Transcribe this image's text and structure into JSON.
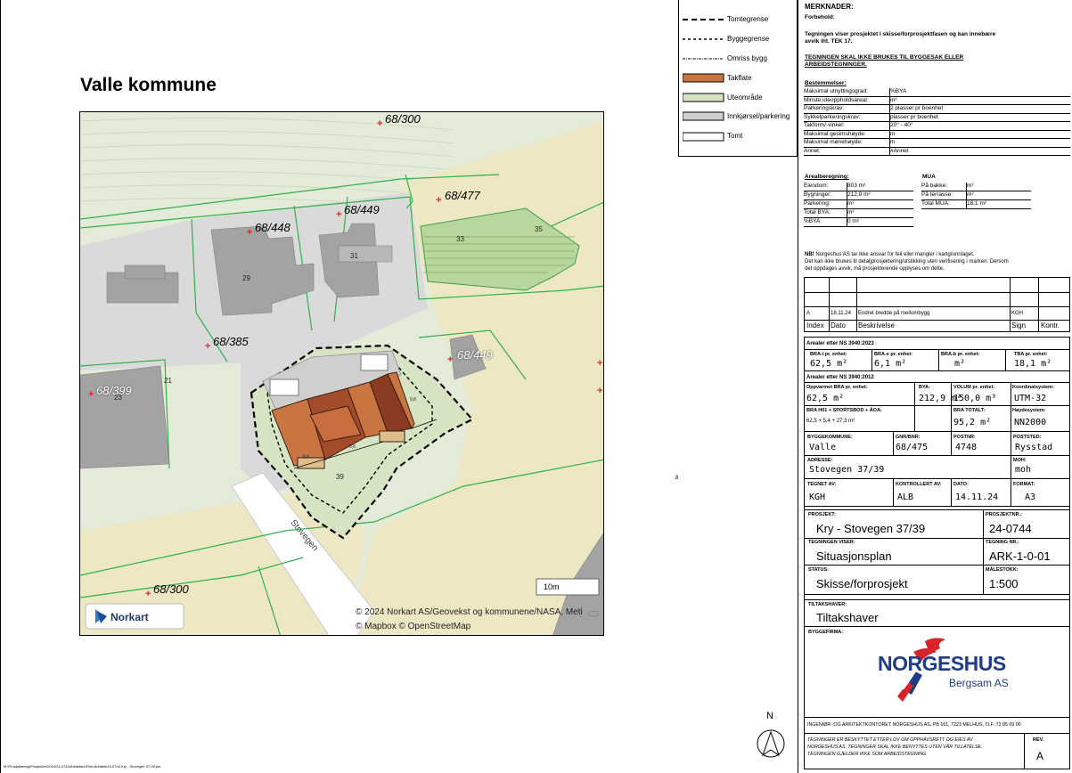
{
  "title": "Valle kommune",
  "map": {
    "attribution_line1": "© 2024 Norkart AS/Geovekst og kommunene/NASA, Meti",
    "attribution_line2": "© Mapbox © OpenStreetMap",
    "logo_text": "Norkart",
    "scale_label": "10m",
    "street_name": "Stovegen",
    "parcels": [
      "68/300",
      "68/477",
      "68/449",
      "68/448",
      "68/385",
      "68/449",
      "68/399",
      "68/300"
    ],
    "house_numbers": [
      "33",
      "35",
      "31",
      "29",
      "21",
      "23",
      "39"
    ],
    "dims": [
      "6,6",
      "5,6",
      "9,8"
    ],
    "side_mark": "8"
  },
  "legend": {
    "items": [
      "Tomtegrense",
      "Byggegrense",
      "Omriss bygg",
      "Takflate",
      "Uteområde",
      "Innkjørsel/parkering",
      "Tomt"
    ],
    "colors": {
      "roof": "#c97542",
      "outdoor": "#d6e4c3",
      "drive": "#cfcfcf"
    }
  },
  "notes": {
    "heading": "MERKNADER:",
    "forbehold": "Forbehold:",
    "line1": "Tegningen viser prosjektet i skisse/forprosjektfasen og kan innebære",
    "line2": "avvik iht. TEK 17.",
    "warn1": "TEGNINGEN SKAL IKKE BRUKES TIL BYGGESAK ELLER",
    "warn2": "ARBEIDSTEGNINGER."
  },
  "bestemmelser": {
    "heading": "Bestemmelser:",
    "rows": [
      [
        "Maksimal utnyttingsgrad:",
        "%BYA"
      ],
      [
        "Minste uteoppholdsareal:",
        "m²"
      ],
      [
        "Parkeringskrav:",
        "2 plasser pr boenhet"
      ],
      [
        "Sykkelparkeringskrav:",
        "plasser pr boenhet"
      ],
      [
        "Takform/-vinkel:",
        "20° - 40°"
      ],
      [
        "Maksimal gesimshøyde:",
        "m"
      ],
      [
        "Maksimal mønehøyde:",
        "m"
      ],
      [
        "Annet:",
        "#Annet"
      ]
    ]
  },
  "arealberegning": {
    "heading": "Arealberegning:",
    "rows": [
      [
        "Eiendom:",
        "803 m²"
      ],
      [
        "Bygninger:",
        "212,9 m²"
      ],
      [
        "Parkering:",
        "m²"
      ],
      [
        "Total BYA:",
        "m²"
      ],
      [
        "%BYA:",
        "0 m²"
      ]
    ]
  },
  "mua": {
    "heading": "MUA",
    "rows": [
      [
        "På bakke:",
        "m²"
      ],
      [
        "På terrasse:",
        "m²"
      ],
      [
        "Total MUA:",
        "18,1 m²"
      ]
    ]
  },
  "disclaimer": {
    "nb": "NB!",
    "line1": " Norgeshus AS tar ikke ansvar for feil eller mangler i kartgrunnlaget.",
    "line2": "Det kan ikke brukes til detaljprosjektering/utstikking uten verifisering i marken. Dersom",
    "line3": "det oppdages avvik, må prosjekterende opplyses om dette."
  },
  "revisions": {
    "row": [
      "A",
      "18.11.24",
      "Endret bredde på mellombygg",
      "KGH",
      ""
    ],
    "headers": [
      "Index",
      "Dato",
      "Beskrivelse",
      "Sign",
      "Kontr."
    ]
  },
  "ns2023": {
    "heading": "Arealer etter NS 3940:2023",
    "cells": [
      {
        "label": "BRA-i pr. enhet:",
        "value": "62,5 m²"
      },
      {
        "label": "BRA-e pr. enhet:",
        "value": "6,1 m²"
      },
      {
        "label": "BRA-b pr. enhet:",
        "value": "m²"
      },
      {
        "label": "TBA pr. enhet:",
        "value": "18,1 m²"
      }
    ]
  },
  "ns2012": {
    "heading": "Arealer etter NS 3940:2012",
    "cells": [
      {
        "label": "Oppvarmet BRA pr. enhet:",
        "value": "62,5 m²"
      },
      {
        "label": "BYA:",
        "value": "212,9 m²"
      },
      {
        "label": "VOLUM pr. enhet:",
        "value": "150,0 m³"
      },
      {
        "label": "Koordinatsystem:",
        "value": "UTM-32"
      }
    ],
    "cells2": [
      {
        "label": "BRA H01 + SPORTSBOD + ÅOA:",
        "value": "62,5 + 5,4 + 27,3 m²"
      },
      {
        "label": "BRA TOTALT:",
        "value": "95,2 m²"
      },
      {
        "label": "Høydesystem:",
        "value": "NN2000"
      }
    ]
  },
  "property": {
    "kommune_label": "BYGGEKOMMUNE:",
    "kommune": "Valle",
    "gnr_label": "GNR/BNR:",
    "gnr": "68/475",
    "postnr_label": "POSTNR:",
    "postnr": "4748",
    "poststed_label": "POSTSTED:",
    "poststed": "Rysstad",
    "adresse_label": "ADRESSE:",
    "adresse": "Stovegen 37/39",
    "moh_label": "MOH:",
    "moh": "moh"
  },
  "drawing": {
    "tegnet_label": "TEGNET AV:",
    "tegnet": "KGH",
    "kontrollert_label": "KONTROLLERT AV:",
    "kontrollert": "ALB",
    "dato_label": "DATO:",
    "dato": "14.11.24",
    "format_label": "FORMAT:",
    "format": "A3"
  },
  "project": {
    "prosjekt_label": "PROSJEKT:",
    "prosjekt": "Kry - Stovegen 37/39",
    "prosjektnr_label": "PROSJEKTNR.:",
    "prosjektnr": "24-0744",
    "viser_label": "TEGNINGEN VISER:",
    "viser": "Situasjonsplan",
    "tegningnr_label": "TEGNING NR.:",
    "tegningnr": "ARK-1-0-01",
    "status_label": "STATUS:",
    "status": "Skisse/forprosjekt",
    "malestokk_label": "MÅLESTOKK:",
    "malestokk": "1:500"
  },
  "tiltakshaver": {
    "label": "TILTAKSHAVER:",
    "value": "Tiltakshaver"
  },
  "byggefirma": {
    "label": "BYGGEFIRMA:",
    "brand": "NORGESHUS",
    "sub": "Bergsam AS"
  },
  "north": "N",
  "footer": {
    "address": "INGENIØR- OG ARKITEKTKONTORET NORGESHUS AS, PB 161, 7223 MELHUS, TLF: 72 85 69 00",
    "legal1": "TEGNINGER ER BESKYTTET ETTER LOV OM OPPHAVSRETT OG EIES AV",
    "legal2": "NORGESHUS AS. TEGNINGER SKAL IKKE BENYTTES UTEN VÅR TILLATELSE.",
    "legal3": "TEGNINGEN GJELDER IKKE SOM ARBEIDSTEGNING.",
    "rev_label": "REV.",
    "rev": "A"
  },
  "filepath": "M:\\Prosjektering\\Prosjekter\\2024\\24-0744\\Arkitektur\\Filer\\Arkitekt\\24-0744 Kry - Stovegen 37-39.pln"
}
